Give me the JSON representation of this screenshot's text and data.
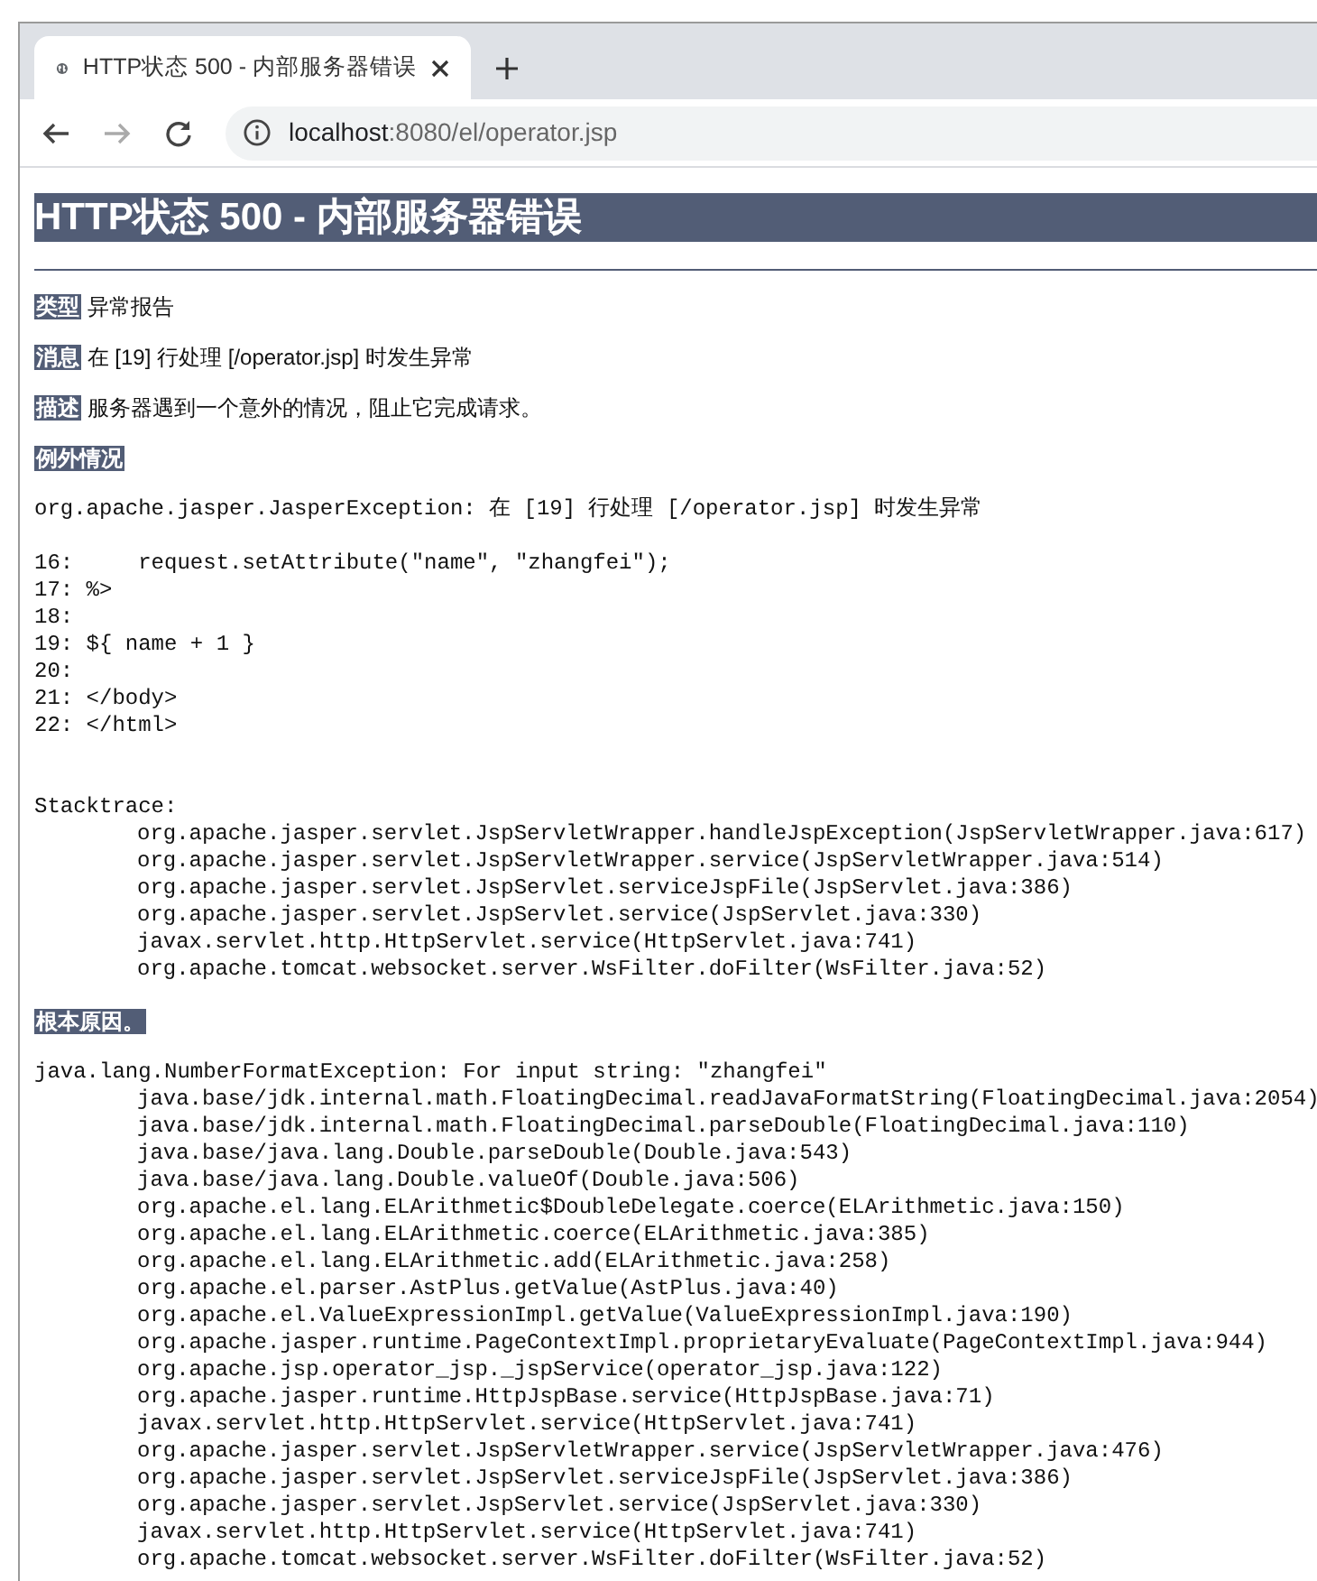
{
  "browser": {
    "tab": {
      "title": "HTTP状态 500 - 内部服务器错误",
      "selected": true
    },
    "address_bar": {
      "host": "localhost",
      "path": ":8080/el/operator.jsp"
    }
  },
  "page": {
    "heading": "HTTP状态 500 - 内部服务器错误",
    "fields": [
      {
        "label": "类型",
        "value": "异常报告"
      },
      {
        "label": "消息",
        "value": "在 [19] 行处理 [/operator.jsp] 时发生异常"
      },
      {
        "label": "描述",
        "value": "服务器遇到一个意外的情况，阻止它完成请求。"
      }
    ],
    "exception_label": "例外情况",
    "exception_message": "org.apache.jasper.JasperException: 在 [19] 行处理 [/operator.jsp] 时发生异常",
    "code_lines": [
      "16:     request.setAttribute(\"name\", \"zhangfei\");",
      "17: %>",
      "18: ",
      "19: ${ name + 1 }",
      "20: ",
      "21: </body>",
      "22: </html>"
    ],
    "stacktrace_label": "Stacktrace:",
    "stack_frames": [
      "org.apache.jasper.servlet.JspServletWrapper.handleJspException(JspServletWrapper.java:617)",
      "org.apache.jasper.servlet.JspServletWrapper.service(JspServletWrapper.java:514)",
      "org.apache.jasper.servlet.JspServlet.serviceJspFile(JspServlet.java:386)",
      "org.apache.jasper.servlet.JspServlet.service(JspServlet.java:330)",
      "javax.servlet.http.HttpServlet.service(HttpServlet.java:741)",
      "org.apache.tomcat.websocket.server.WsFilter.doFilter(WsFilter.java:52)"
    ],
    "root_cause_label": "根本原因。",
    "root_cause_message": "java.lang.NumberFormatException: For input string: \"zhangfei\"",
    "root_cause_frames": [
      "java.base/jdk.internal.math.FloatingDecimal.readJavaFormatString(FloatingDecimal.java:2054)",
      "java.base/jdk.internal.math.FloatingDecimal.parseDouble(FloatingDecimal.java:110)",
      "java.base/java.lang.Double.parseDouble(Double.java:543)",
      "java.base/java.lang.Double.valueOf(Double.java:506)",
      "org.apache.el.lang.ELArithmetic$DoubleDelegate.coerce(ELArithmetic.java:150)",
      "org.apache.el.lang.ELArithmetic.coerce(ELArithmetic.java:385)",
      "org.apache.el.lang.ELArithmetic.add(ELArithmetic.java:258)",
      "org.apache.el.parser.AstPlus.getValue(AstPlus.java:40)",
      "org.apache.el.ValueExpressionImpl.getValue(ValueExpressionImpl.java:190)",
      "org.apache.jasper.runtime.PageContextImpl.proprietaryEvaluate(PageContextImpl.java:944)",
      "org.apache.jsp.operator_jsp._jspService(operator_jsp.java:122)",
      "org.apache.jasper.runtime.HttpJspBase.service(HttpJspBase.java:71)",
      "javax.servlet.http.HttpServlet.service(HttpServlet.java:741)",
      "org.apache.jasper.servlet.JspServletWrapper.service(JspServletWrapper.java:476)",
      "org.apache.jasper.servlet.JspServlet.serviceJspFile(JspServlet.java:386)",
      "org.apache.jasper.servlet.JspServlet.service(JspServlet.java:330)",
      "javax.servlet.http.HttpServlet.service(HttpServlet.java:741)",
      "org.apache.tomcat.websocket.server.WsFilter.doFilter(WsFilter.java:52)"
    ]
  }
}
